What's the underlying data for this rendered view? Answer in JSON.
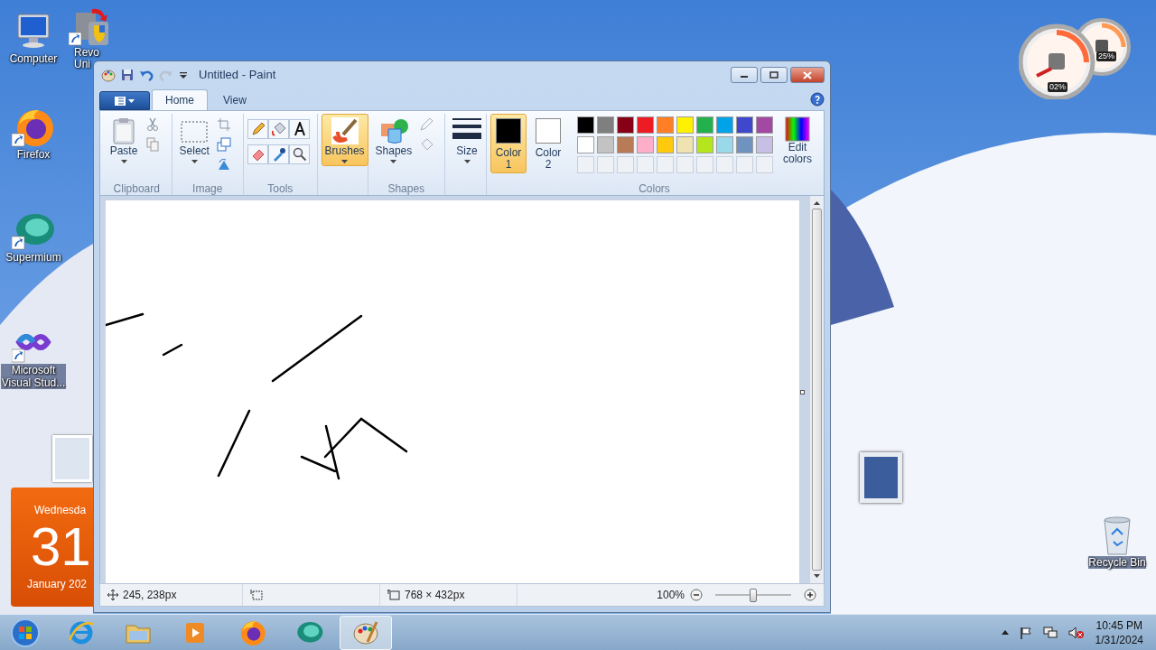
{
  "desktop_icons": [
    {
      "kind": "computer",
      "label": "Computer"
    },
    {
      "kind": "uninstaller",
      "label": "Revo Uni"
    },
    {
      "kind": "firefox",
      "label": "Firefox"
    },
    {
      "kind": "supermium",
      "label": "Supermium"
    },
    {
      "kind": "visual-studio",
      "label": "Microsoft Visual Stud..."
    }
  ],
  "calendar_gadget": {
    "weekday": "Wednesda",
    "day": "31",
    "month_year": "January 202"
  },
  "meter_gadget": {
    "readings": [
      "02%",
      "25%"
    ]
  },
  "recycle_bin": {
    "label": "Recycle Bin"
  },
  "paint": {
    "title": "Untitled - Paint",
    "tabs": [
      {
        "label": "Home",
        "selected": true
      },
      {
        "label": "View",
        "selected": false
      }
    ],
    "clipboard": {
      "label": "Clipboard",
      "paste": "Paste"
    },
    "image": {
      "label": "Image",
      "select": "Select"
    },
    "tools": {
      "label": "Tools"
    },
    "brushes": {
      "label": "Brushes",
      "selected": true
    },
    "shapes": {
      "label": "Shapes",
      "button": "Shapes"
    },
    "size": {
      "label": "Size"
    },
    "colors": {
      "label": "Colors",
      "color1": {
        "label": "Color 1",
        "color": "#000000",
        "selected": true
      },
      "color2": {
        "label": "Color 2",
        "color": "#ffffff",
        "selected": false
      },
      "palette": [
        {
          "color": "#000000"
        },
        {
          "color": "#7f7f7f"
        },
        {
          "color": "#880015"
        },
        {
          "color": "#ed1c24"
        },
        {
          "color": "#ff7f27"
        },
        {
          "color": "#fff200"
        },
        {
          "color": "#22b14c"
        },
        {
          "color": "#00a2e8"
        },
        {
          "color": "#3f48cc"
        },
        {
          "color": "#a349a4"
        },
        {
          "color": "#ffffff"
        },
        {
          "color": "#c3c3c3"
        },
        {
          "color": "#b97a57"
        },
        {
          "color": "#ffaec9"
        },
        {
          "color": "#ffc90e"
        },
        {
          "color": "#efe4b0"
        },
        {
          "color": "#b5e61d"
        },
        {
          "color": "#99d9ea"
        },
        {
          "color": "#7092be"
        },
        {
          "color": "#c8bfe7"
        }
      ],
      "edit": "Edit colors"
    },
    "status": {
      "position": "245, 238px",
      "image_size": "768 × 432px",
      "zoom": "100%",
      "zoom_slider": {
        "level": 0.5
      }
    }
  },
  "taskbar": {
    "apps": [
      {
        "kind": "internet-explorer",
        "selected": false
      },
      {
        "kind": "folder",
        "selected": false
      },
      {
        "kind": "media-player",
        "selected": false
      },
      {
        "kind": "firefox",
        "selected": false
      },
      {
        "kind": "supermium",
        "selected": false
      },
      {
        "kind": "paint",
        "selected": true
      }
    ],
    "time": "10:45 PM",
    "date": "1/31/2024"
  }
}
